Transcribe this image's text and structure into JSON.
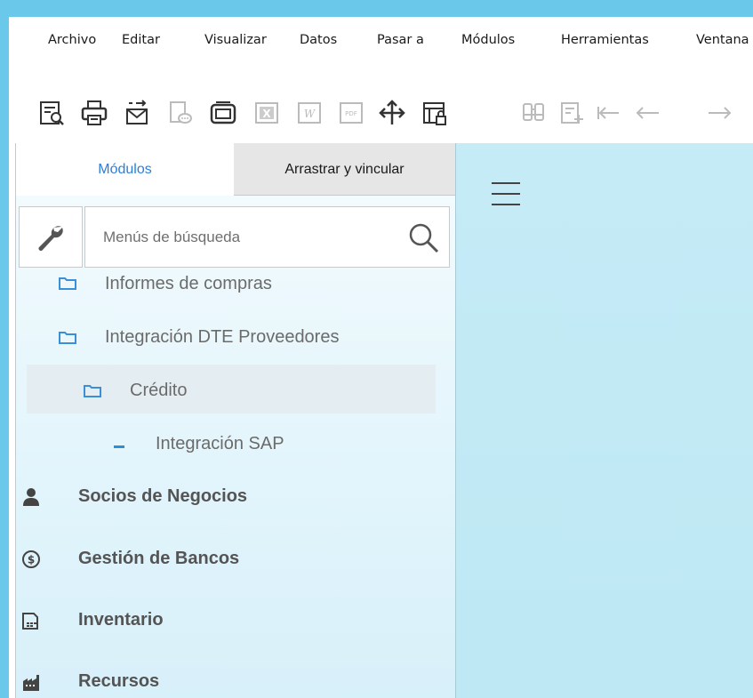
{
  "menubar": {
    "items": [
      "Archivo",
      "Editar",
      "Visualizar",
      "Datos",
      "Pasar a",
      "Módulos",
      "Herramientas",
      "Ventana"
    ]
  },
  "toolbar": {
    "icons": [
      "preview-icon",
      "print-icon",
      "email-icon",
      "sms-icon",
      "fax-icon",
      "excel-icon",
      "word-icon",
      "pdf-icon",
      "move-icon",
      "lock-form-icon",
      "find-icon",
      "add-icon",
      "first-record-icon",
      "previous-record-icon",
      "next-record-icon"
    ]
  },
  "panel": {
    "tabs": {
      "modulos": "Módulos",
      "arrastrar": "Arrastrar y vincular"
    },
    "search": {
      "placeholder": "Menús de búsqueda",
      "value": ""
    },
    "tree": [
      "Informes de compras",
      "Integración DTE Proveedores",
      "Crédito",
      "Integración SAP"
    ],
    "modules": [
      "Socios de Negocios",
      "Gestión de Bancos",
      "Inventario",
      "Recursos"
    ]
  },
  "colors": {
    "frame": "#6ac8ea",
    "tab_active_text": "#2b7fd9",
    "content_bg": "#c5ebf6"
  }
}
